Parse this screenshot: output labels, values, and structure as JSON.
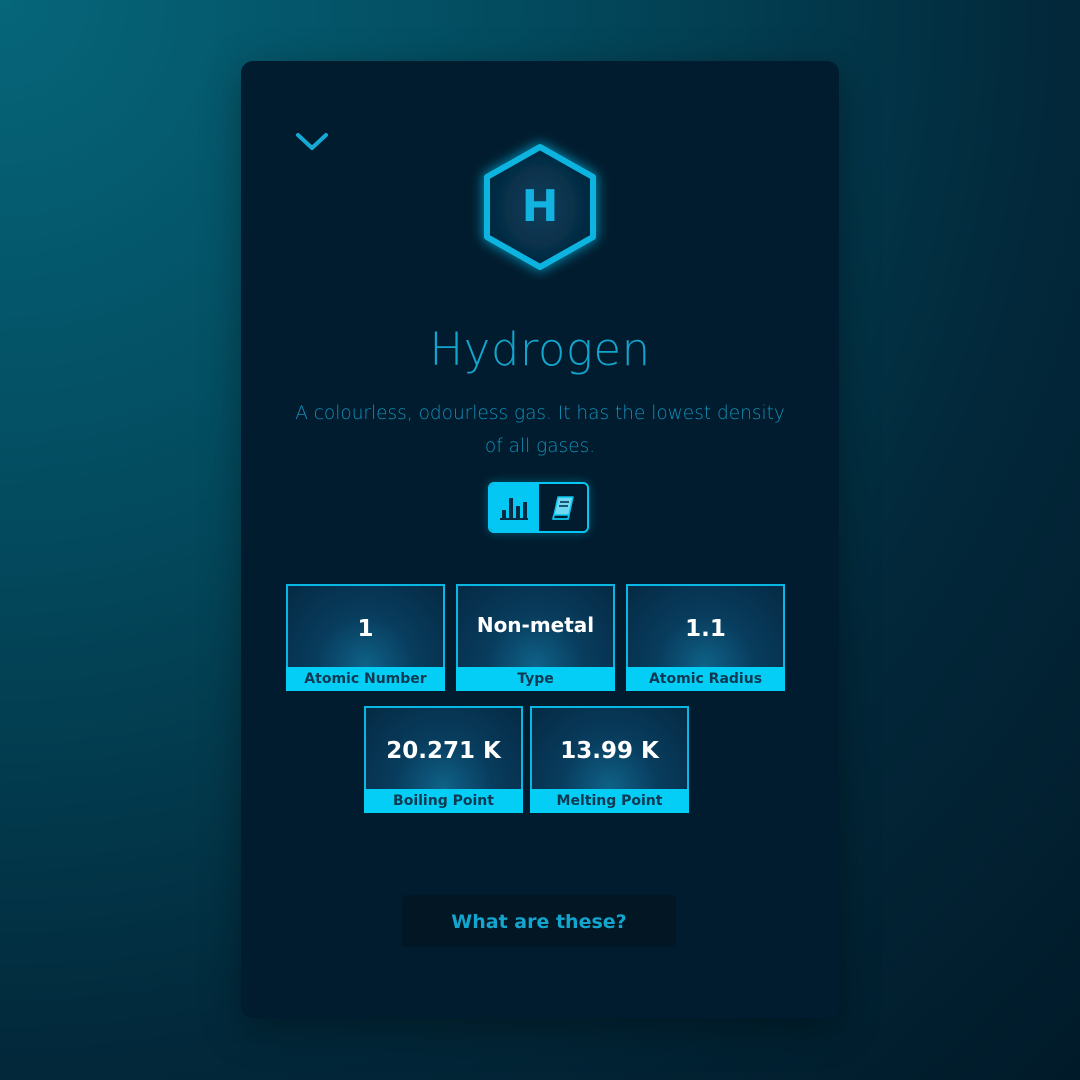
{
  "element": {
    "symbol": "H",
    "name": "Hydrogen",
    "description": "A colourless, odourless gas. It has the lowest density of all gases."
  },
  "controls": {
    "collapse_icon": "chevron-down-icon",
    "view_toggle": [
      {
        "icon": "bar-chart-icon",
        "active": true
      },
      {
        "icon": "book-icon",
        "active": false
      }
    ]
  },
  "stats": [
    {
      "value": "1",
      "label": "Atomic Number"
    },
    {
      "value": "Non-metal",
      "label": "Type"
    },
    {
      "value": "1.1",
      "label": "Atomic Radius"
    },
    {
      "value": "20.271 K",
      "label": "Boiling Point"
    },
    {
      "value": "13.99 K",
      "label": "Melting Point"
    }
  ],
  "help": {
    "label": "What are these?"
  },
  "colors": {
    "accent": "#04c8f3",
    "card_background": "#011c2e",
    "title_text": "#12a6cf",
    "label_text": "#0d3a52"
  }
}
